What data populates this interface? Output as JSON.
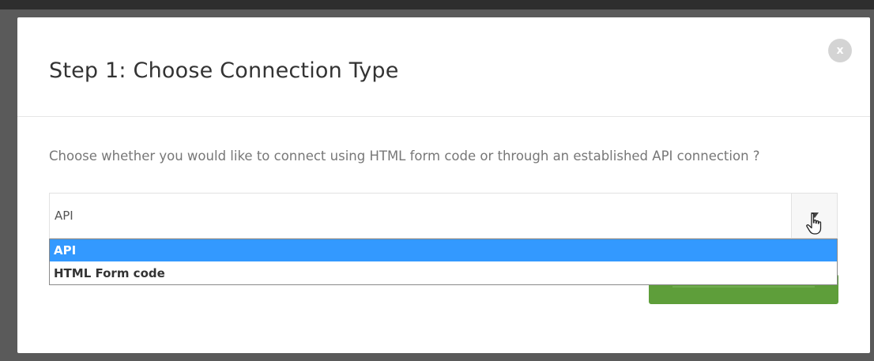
{
  "modal": {
    "title": "Step 1: Choose Connection Type",
    "close_label": "x",
    "description": "Choose whether you would like to connect using HTML form code or through an established API connection ?",
    "select": {
      "current_value": "API",
      "options": [
        "API",
        "HTML Form code"
      ],
      "highlighted_option": "API"
    },
    "action_button": {
      "color": "#5e9e3a"
    }
  },
  "colors": {
    "highlight": "#3399ff",
    "action_green": "#5e9e3a"
  }
}
